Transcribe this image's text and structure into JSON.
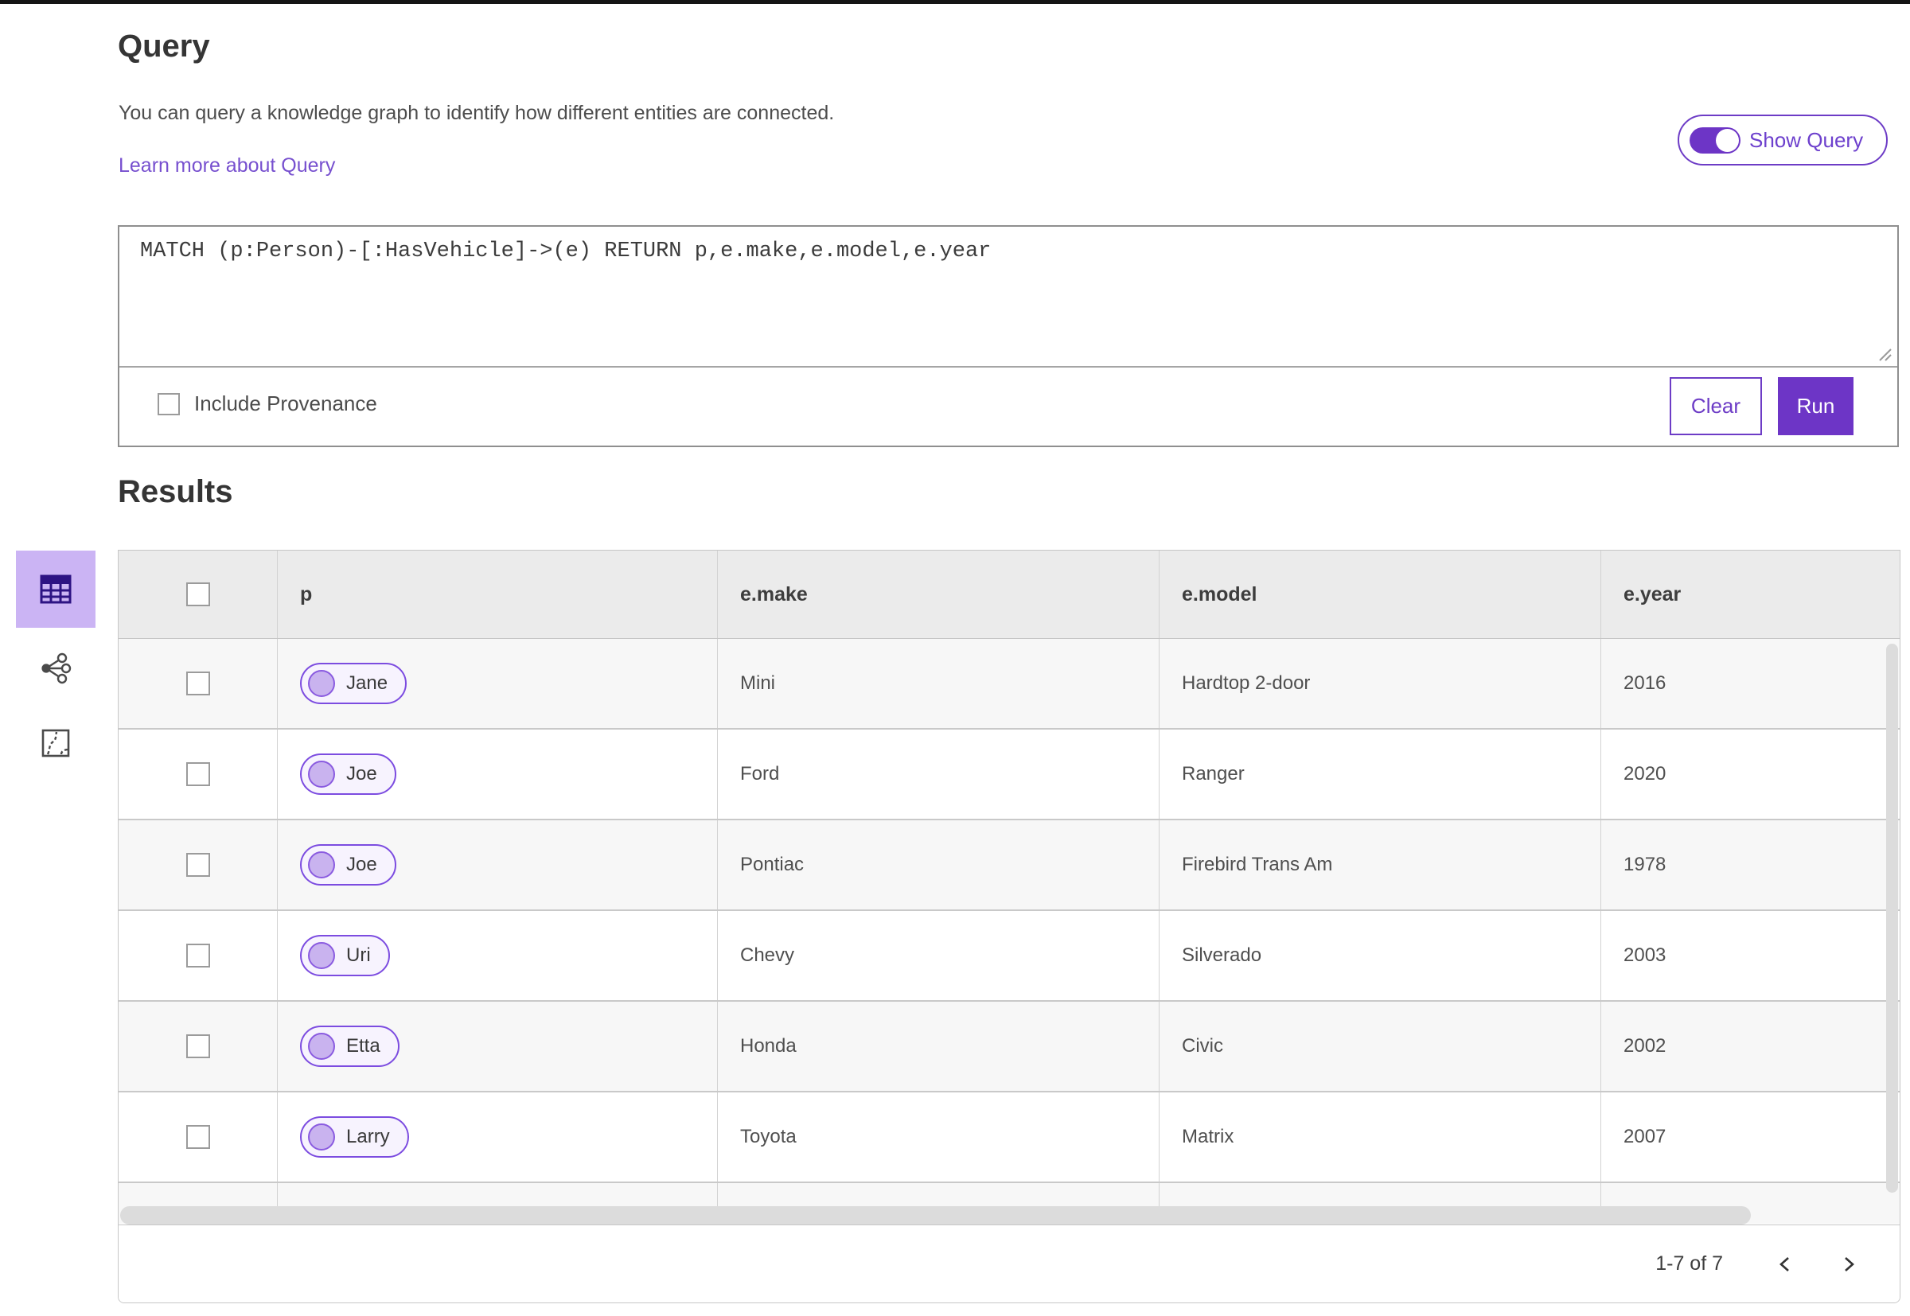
{
  "colors": {
    "accent_purple": "#6d35c6",
    "link_purple": "#7750cf",
    "pill_border": "#7c4ce0",
    "pill_fill": "#f7f3fe",
    "node_fill": "#c9b3ef",
    "active_tile_bg": "#cbb4f4",
    "active_icon": "#2d1383",
    "header_bg": "#ebebeb",
    "row_alt_bg": "#f7f7f7",
    "scrollbar": "#dcdcdc"
  },
  "query_section": {
    "title": "Query",
    "description": "You can query a knowledge graph to identify how different entities are connected.",
    "learn_more_link": "Learn more about Query",
    "show_query_toggle": {
      "label": "Show Query",
      "state": "on"
    },
    "query_text": "MATCH (p:Person)-[:HasVehicle]->(e) RETURN p,e.make,e.model,e.year",
    "include_provenance": {
      "label": "Include Provenance",
      "checked": false
    },
    "clear_button_label": "Clear",
    "run_button_label": "Run"
  },
  "results_section": {
    "title": "Results",
    "view_switcher": {
      "active_view": "table",
      "views": [
        {
          "id": "table",
          "icon": "table-grid-icon"
        },
        {
          "id": "link-chart",
          "icon": "link-chart-nodes-icon"
        },
        {
          "id": "map",
          "icon": "map-outline-icon"
        }
      ]
    },
    "table": {
      "columns": [
        "p",
        "e.make",
        "e.model",
        "e.year"
      ],
      "rows": [
        {
          "p": "Jane",
          "e_make": "Mini",
          "e_model": "Hardtop 2-door",
          "e_year": "2016"
        },
        {
          "p": "Joe",
          "e_make": "Ford",
          "e_model": "Ranger",
          "e_year": "2020"
        },
        {
          "p": "Joe",
          "e_make": "Pontiac",
          "e_model": "Firebird Trans Am",
          "e_year": "1978"
        },
        {
          "p": "Uri",
          "e_make": "Chevy",
          "e_model": "Silverado",
          "e_year": "2003"
        },
        {
          "p": "Etta",
          "e_make": "Honda",
          "e_model": "Civic",
          "e_year": "2002"
        },
        {
          "p": "Larry",
          "e_make": "Toyota",
          "e_model": "Matrix",
          "e_year": "2007"
        }
      ],
      "partial_row_visible": true
    },
    "pagination": {
      "range_label": "1-7 of 7",
      "prev_icon": "chevron-left-icon",
      "next_icon": "chevron-right-icon"
    }
  }
}
